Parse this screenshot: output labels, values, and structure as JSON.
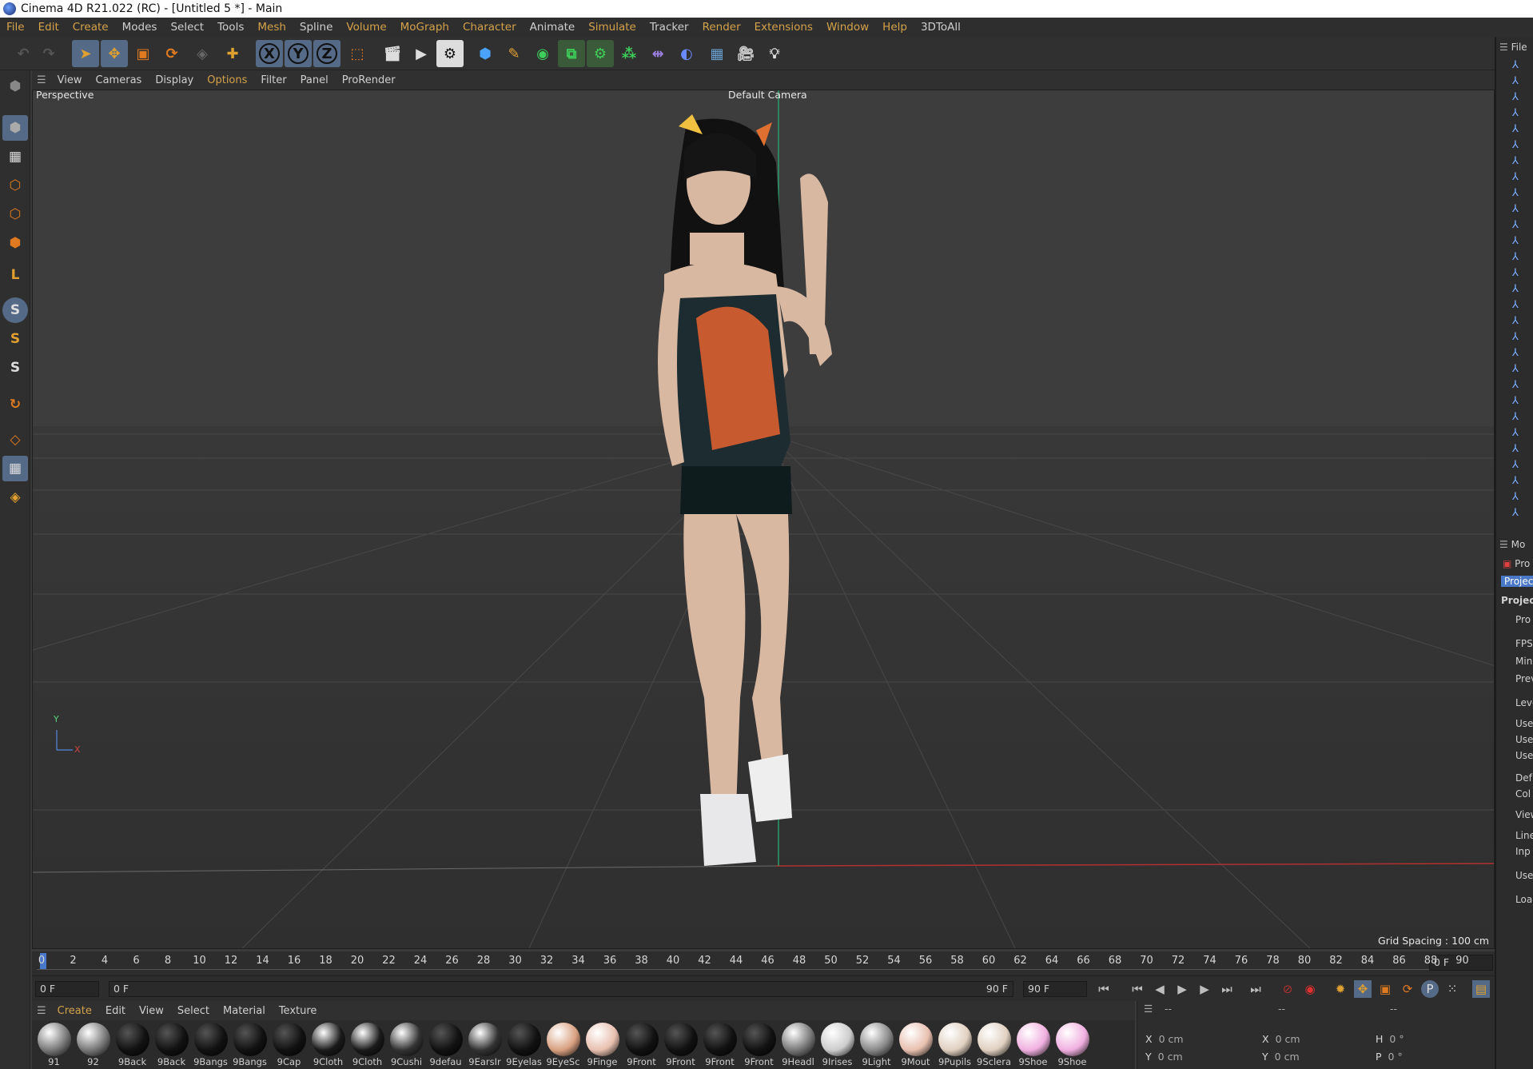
{
  "window": {
    "title": "Cinema 4D R21.022 (RC) - [Untitled 5 *] - Main"
  },
  "menu": [
    "File",
    "Edit",
    "Create",
    "Modes",
    "Select",
    "Tools",
    "Mesh",
    "Spline",
    "Volume",
    "MoGraph",
    "Character",
    "Animate",
    "Simulate",
    "Tracker",
    "Render",
    "Extensions",
    "Window",
    "Help",
    "3DToAll"
  ],
  "toolbar": {
    "axis_x": "X",
    "axis_y": "Y",
    "axis_z": "Z"
  },
  "viewport_menu": [
    "View",
    "Cameras",
    "Display",
    "Options",
    "Filter",
    "Panel",
    "ProRender"
  ],
  "viewport": {
    "name": "Perspective",
    "camera": "Default Camera",
    "grid_spacing": "Grid Spacing : 100 cm",
    "axis_y": "Y",
    "axis_x": "X"
  },
  "timeline": {
    "ticks": [
      "0",
      "2",
      "4",
      "6",
      "8",
      "10",
      "12",
      "14",
      "16",
      "18",
      "20",
      "22",
      "24",
      "26",
      "28",
      "30",
      "32",
      "34",
      "36",
      "38",
      "40",
      "42",
      "44",
      "46",
      "48",
      "50",
      "52",
      "54",
      "56",
      "58",
      "60",
      "62",
      "64",
      "66",
      "68",
      "70",
      "72",
      "74",
      "76",
      "78",
      "80",
      "82",
      "84",
      "86",
      "88",
      "90"
    ],
    "current_frame": "0 F"
  },
  "transport": {
    "start": "0 F",
    "preview_start": "0 F",
    "preview_end": "90 F",
    "end": "90 F"
  },
  "material_menu": [
    "Create",
    "Edit",
    "View",
    "Select",
    "Material",
    "Texture"
  ],
  "materials": [
    "91",
    "92",
    "9Back",
    "9Back",
    "9Bangs",
    "9Bangs",
    "9Cap",
    "9Cloth",
    "9Cloth",
    "9Cushi",
    "9defau",
    "9EarsIr",
    "9Eyelas",
    "9EyeSc",
    "9Finge",
    "9Front",
    "9Front",
    "9Front",
    "9Front",
    "9Headl",
    "9Irises",
    "9Light",
    "9Mout",
    "9Pupils",
    "9Sclera",
    "9Shoe",
    "9Shoe"
  ],
  "coordinates": {
    "x_pos": "0 cm",
    "y_pos": "0 cm",
    "x_size": "0 cm",
    "y_size": "0 cm",
    "h": "0 °",
    "p": "0 °",
    "dash1": "--",
    "dash2": "--",
    "dash3": "--"
  },
  "right_panel": {
    "objects_header": "File",
    "attrs_header": "Mo",
    "tab_project": "Project",
    "section": "Project",
    "labels": [
      "Pro",
      "FPS",
      "Min",
      "Prev",
      "Leve",
      "Use",
      "Use",
      "Use",
      "Def",
      "Col",
      "View",
      "Line",
      "Inp",
      "Use",
      "Loa"
    ],
    "pro_item": "Pro"
  }
}
